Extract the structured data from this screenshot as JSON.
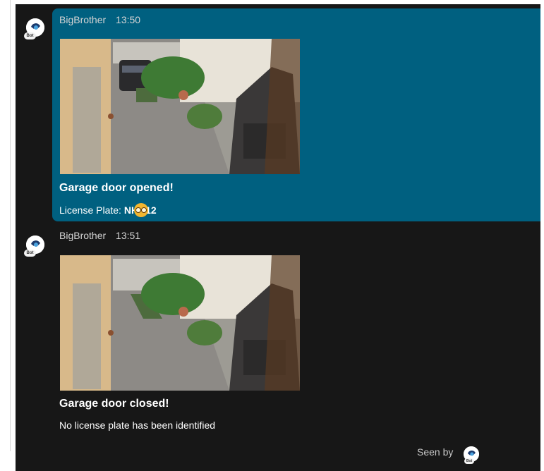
{
  "messages": [
    {
      "sender": "BigBrother",
      "time": "13:50",
      "avatar_badge": "Bot",
      "title": "Garage door opened!",
      "line_prefix": "License Plate: ",
      "plate_start": "NH",
      "plate_end": "12",
      "highlighted": true,
      "image_icon": "camera-snapshot-garage-car"
    },
    {
      "sender": "BigBrother",
      "time": "13:51",
      "avatar_badge": "Bot",
      "title": "Garage door closed!",
      "line_text": "No license plate has been identified",
      "highlighted": false,
      "image_icon": "camera-snapshot-garage-empty"
    }
  ],
  "footer": {
    "seen_by_label": "Seen by",
    "avatar_badge": "Bot"
  },
  "colors": {
    "highlight": "#006080",
    "background": "#171717"
  }
}
